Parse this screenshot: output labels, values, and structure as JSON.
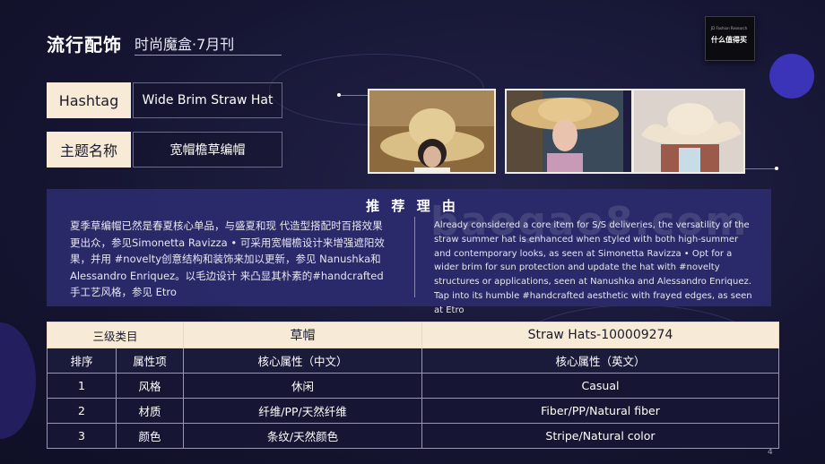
{
  "header": {
    "title": "流行配饰",
    "subtitle": "时尚魔盒·7月刊",
    "logo_text": "什么值得买",
    "logo_small": "JD Fashion Research"
  },
  "info": {
    "hashtag_label": "Hashtag",
    "hashtag_value": "Wide Brim Straw Hat",
    "theme_label": "主题名称",
    "theme_value": "宽帽檐草编帽"
  },
  "reason": {
    "title": "推 荐 理 由",
    "text_cn": "夏季草编帽已然是春夏核心单品，与盛夏和现 代造型搭配时百搭效果更出众，参见Simonetta Ravizza • 可采用宽帽檐设计来增强遮阳效果，并用 #novelty创意结构和装饰来加以更新，参见 Nanushka和Alessandro Enriquez。以毛边设计 来凸显其朴素的#handcrafted手工艺风格，参见 Etro",
    "text_en": "Already considered a core item for S/S deliveries, the versatility of the straw summer hat is enhanced when styled with both high-summer and contemporary looks, as seen at Simonetta Ravizza • Opt for a wider brim for sun protection and update the hat with #novelty structures or applications, seen at Nanushka and Alessandro Enriquez. Tap into its humble #handcrafted aesthetic with frayed edges, as seen at Etro"
  },
  "watermark": "baogao8.com",
  "table": {
    "category_label": "三级类目",
    "category_cn": "草帽",
    "category_en": "Straw Hats-100009274",
    "headers": [
      "排序",
      "属性项",
      "核心属性（中文）",
      "核心属性（英文）"
    ],
    "rows": [
      [
        "1",
        "风格",
        "休闲",
        "Casual"
      ],
      [
        "2",
        "材质",
        "纤维/PP/天然纤维",
        "Fiber/PP/Natural fiber"
      ],
      [
        "3",
        "颜色",
        "条纹/天然颜色",
        "Stripe/Natural color"
      ]
    ]
  },
  "page_number": "4",
  "colors": {
    "background": "#161634",
    "accent_cream": "#f7ead7",
    "reason_panel": "#2b2a6b",
    "deco_purple": "#3b33b8"
  }
}
